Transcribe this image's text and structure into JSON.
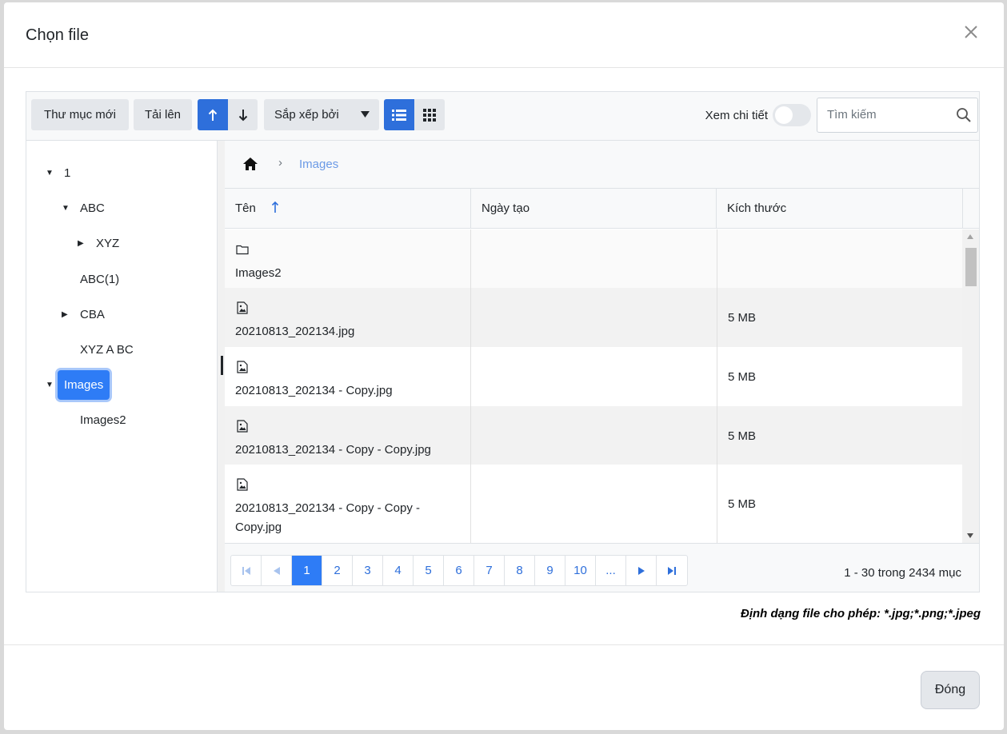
{
  "dialog": {
    "title": "Chọn file",
    "close_icon": "close-icon"
  },
  "toolbar": {
    "new_folder": "Thư mục mới",
    "upload": "Tải lên",
    "sort_by": "Sắp xếp bởi",
    "details_label": "Xem chi tiết",
    "search_placeholder": "Tìm kiếm"
  },
  "tree": {
    "items": [
      {
        "label": "1",
        "expanded": true
      },
      {
        "label": "ABC",
        "expanded": true
      },
      {
        "label": "XYZ",
        "expanded": false
      },
      {
        "label": "ABC(1)"
      },
      {
        "label": "CBA",
        "expanded": false
      },
      {
        "label": "XYZ A BC"
      },
      {
        "label": "Images",
        "expanded": true,
        "selected": true
      },
      {
        "label": "Images2"
      }
    ]
  },
  "breadcrumb": {
    "current": "Images",
    "separator": "›"
  },
  "grid": {
    "columns": [
      "Tên",
      "Ngày tạo",
      "Kích thước"
    ],
    "rows": [
      {
        "name": "Images2",
        "type": "folder",
        "date": "",
        "size": ""
      },
      {
        "name": "20210813_202134.jpg",
        "type": "image",
        "date": "",
        "size": "5 MB"
      },
      {
        "name": "20210813_202134 - Copy.jpg",
        "type": "image",
        "date": "",
        "size": "5 MB"
      },
      {
        "name": "20210813_202134 - Copy - Copy.jpg",
        "type": "image",
        "date": "",
        "size": "5 MB"
      },
      {
        "name": "20210813_202134 - Copy - Copy - Copy.jpg",
        "type": "image",
        "date": "",
        "size": "5 MB"
      }
    ]
  },
  "pager": {
    "pages": [
      "1",
      "2",
      "3",
      "4",
      "5",
      "6",
      "7",
      "8",
      "9",
      "10",
      "..."
    ],
    "current": "1",
    "info": "1 - 30 trong 2434 mục"
  },
  "allowed_formats": "Định dạng file cho phép: *.jpg;*.png;*.jpeg",
  "footer": {
    "close_label": "Đóng"
  },
  "colors": {
    "accent": "#2e6fdb",
    "selected": "#2e7cf6"
  }
}
